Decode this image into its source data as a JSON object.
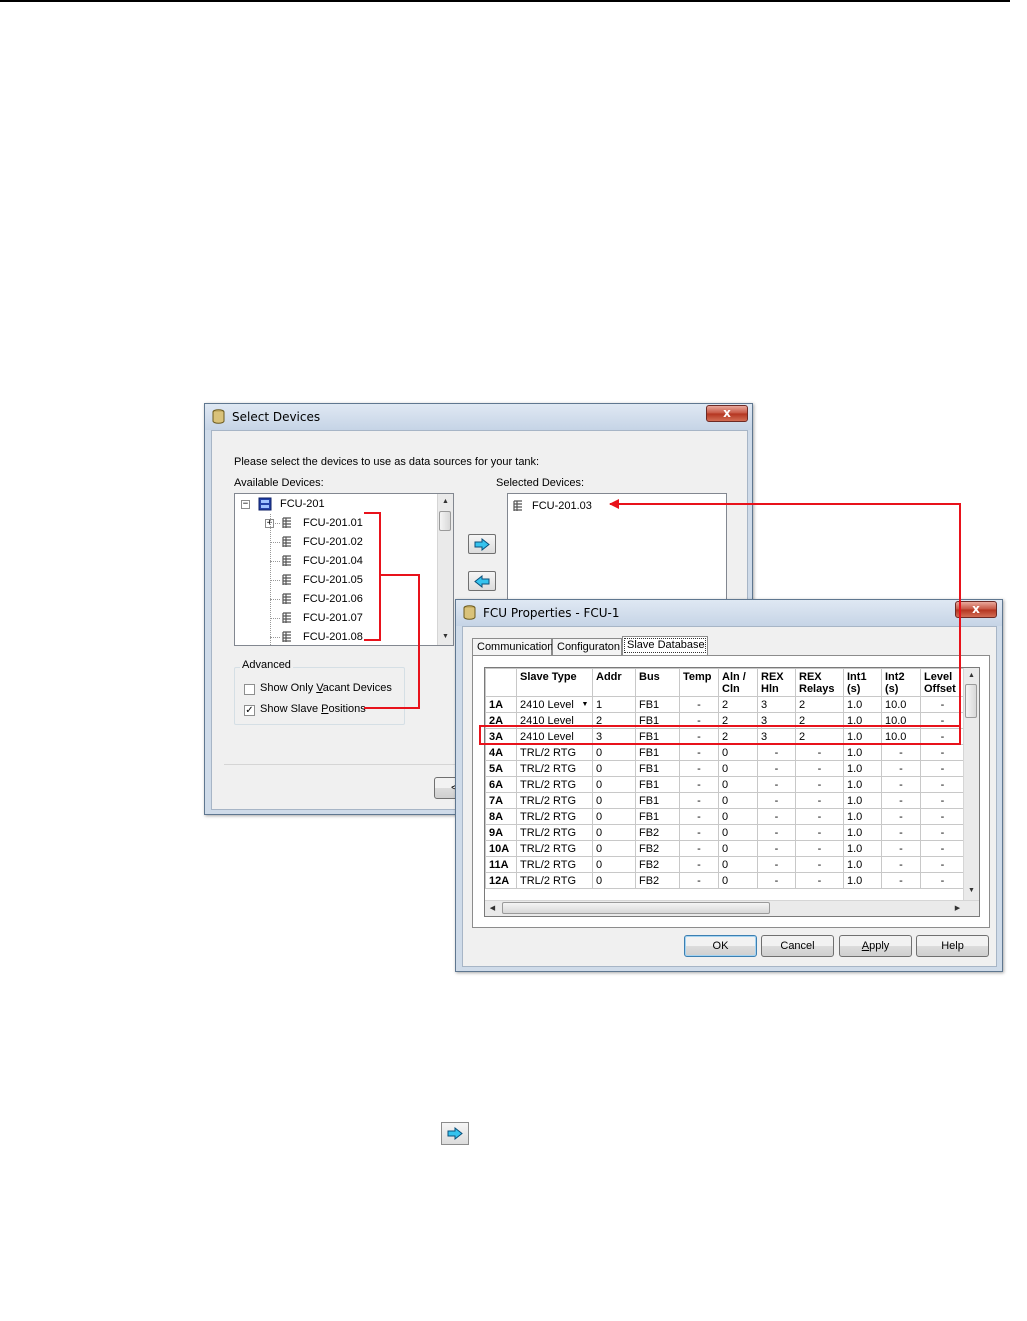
{
  "select_devices": {
    "title": "Select Devices",
    "close_label": "x",
    "instruction": "Please select the devices to use as data sources for your tank:",
    "available_label": "Available Devices:",
    "selected_label": "Selected Devices:",
    "tree_root": "FCU-201",
    "tree_items": [
      "FCU-201.01",
      "FCU-201.02",
      "FCU-201.04",
      "FCU-201.05",
      "FCU-201.06",
      "FCU-201.07",
      "FCU-201.08"
    ],
    "selected_items": [
      "FCU-201.03"
    ],
    "advanced_legend": "Advanced",
    "show_vacant_pre": "Show Only ",
    "show_vacant_u": "V",
    "show_vacant_post": "acant Devices",
    "show_vacant_checked": false,
    "show_slave_pre": "Show Slave ",
    "show_slave_u": "P",
    "show_slave_post": "ositions",
    "show_slave_checked": true,
    "back_button_partial": "<"
  },
  "fcu_properties": {
    "title": "FCU Properties - FCU-1",
    "close_label": "x",
    "tabs": [
      "Communication",
      "Configuraton",
      "Slave Database"
    ],
    "active_tab": "Slave Database",
    "columns": [
      [
        "",
        ""
      ],
      [
        "Slave Type",
        ""
      ],
      [
        "Addr",
        ""
      ],
      [
        "Bus",
        ""
      ],
      [
        "Temp",
        ""
      ],
      [
        "Aln /",
        "Cln"
      ],
      [
        "REX",
        "Hln"
      ],
      [
        "REX",
        "Relays"
      ],
      [
        "Int1",
        "(s)"
      ],
      [
        "Int2",
        "(s)"
      ],
      [
        "Level",
        "Offset"
      ]
    ],
    "rows": [
      [
        "1A",
        "2410 Level",
        "1",
        "FB1",
        "-",
        "2",
        "3",
        "2",
        "1.0",
        "10.0",
        "-"
      ],
      [
        "2A",
        "2410 Level",
        "2",
        "FB1",
        "-",
        "2",
        "3",
        "2",
        "1.0",
        "10.0",
        "-"
      ],
      [
        "3A",
        "2410 Level",
        "3",
        "FB1",
        "-",
        "2",
        "3",
        "2",
        "1.0",
        "10.0",
        "-"
      ],
      [
        "4A",
        "TRL/2 RTG",
        "0",
        "FB1",
        "-",
        "0",
        "-",
        "-",
        "1.0",
        "-",
        "-"
      ],
      [
        "5A",
        "TRL/2 RTG",
        "0",
        "FB1",
        "-",
        "0",
        "-",
        "-",
        "1.0",
        "-",
        "-"
      ],
      [
        "6A",
        "TRL/2 RTG",
        "0",
        "FB1",
        "-",
        "0",
        "-",
        "-",
        "1.0",
        "-",
        "-"
      ],
      [
        "7A",
        "TRL/2 RTG",
        "0",
        "FB1",
        "-",
        "0",
        "-",
        "-",
        "1.0",
        "-",
        "-"
      ],
      [
        "8A",
        "TRL/2 RTG",
        "0",
        "FB1",
        "-",
        "0",
        "-",
        "-",
        "1.0",
        "-",
        "-"
      ],
      [
        "9A",
        "TRL/2 RTG",
        "0",
        "FB2",
        "-",
        "0",
        "-",
        "-",
        "1.0",
        "-",
        "-"
      ],
      [
        "10A",
        "TRL/2 RTG",
        "0",
        "FB2",
        "-",
        "0",
        "-",
        "-",
        "1.0",
        "-",
        "-"
      ],
      [
        "11A",
        "TRL/2 RTG",
        "0",
        "FB2",
        "-",
        "0",
        "-",
        "-",
        "1.0",
        "-",
        "-"
      ],
      [
        "12A",
        "TRL/2 RTG",
        "0",
        "FB2",
        "-",
        "0",
        "-",
        "-",
        "1.0",
        "-",
        "-"
      ]
    ],
    "buttons": {
      "ok": "OK",
      "cancel": "Cancel",
      "apply_u": "A",
      "apply_rest": "pply",
      "help": "Help"
    }
  },
  "colors": {
    "annotation_red": "#e8121b",
    "arrow_fill": "#35c3ee"
  },
  "icons": [
    "database-icon",
    "fcu-device-icon",
    "slave-device-icon",
    "right-arrow-icon",
    "left-arrow-icon"
  ]
}
